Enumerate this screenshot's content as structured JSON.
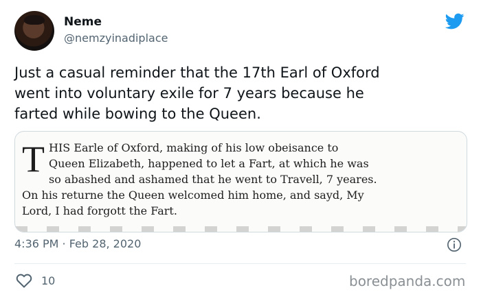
{
  "author": {
    "name": "Neme",
    "handle": "@nemzyinadiplace"
  },
  "tweet": {
    "text_line1": "Just a casual reminder that the 17th Earl of Oxford",
    "text_line2": "went into voluntary exile for 7 years because he",
    "text_line3": "farted while bowing to the Queen."
  },
  "media": {
    "dropcap": "T",
    "line1": "HIS Earle of Oxford, making of his low obeisance to",
    "line2": "Queen Elizabeth, happened to let a Fart, at which he was",
    "line3": "so abashed and ashamed that he went to Travell, 7 yeares.",
    "line4": "On his returne the Queen welcomed him home, and sayd, My",
    "line5": "Lord, I had forgott the Fart."
  },
  "meta": {
    "timestamp": "4:36 PM · Feb 28, 2020",
    "likes": "10"
  },
  "watermark": "boredpanda.com",
  "colors": {
    "twitter_blue": "#1d9bf0",
    "secondary_text": "#536471"
  },
  "icons": {
    "brand": "twitter-bird-icon",
    "info": "info-icon",
    "like": "heart-icon"
  }
}
